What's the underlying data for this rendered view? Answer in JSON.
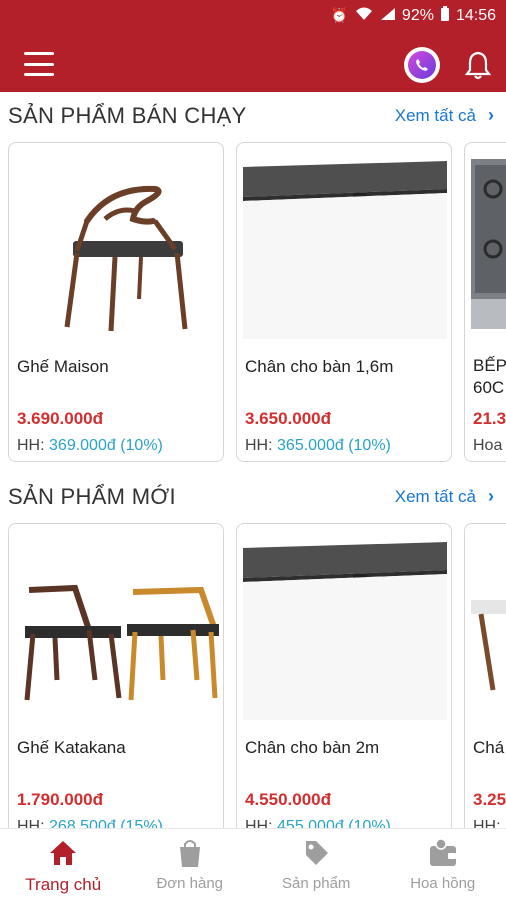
{
  "status": {
    "battery": "92%",
    "time": "14:56"
  },
  "colors": {
    "brand": "#b3202a",
    "price": "#d32f2f",
    "link": "#1976d2",
    "commission": "#29a3c7"
  },
  "sections": [
    {
      "title": "SẢN PHẨM BÁN CHẠY",
      "see_all": "Xem tất cả",
      "products": [
        {
          "name": "Ghế  Maison",
          "price": "3.690.000đ",
          "comm_label": "HH:",
          "comm_value": "369.000đ (10%)"
        },
        {
          "name": "Chân cho bàn 1,6m",
          "price": "3.650.000đ",
          "comm_label": "HH:",
          "comm_value": "365.000đ (10%)"
        },
        {
          "name": "BẾP",
          "name2": "60C",
          "price": "21.3",
          "comm_label": "Hoa"
        }
      ]
    },
    {
      "title": "SẢN PHẨM MỚI",
      "see_all": "Xem tất cả",
      "products": [
        {
          "name": "Ghế Katakana",
          "price": "1.790.000đ",
          "comm_label": "HH:",
          "comm_value": "268.500đ (15%)"
        },
        {
          "name": "Chân cho bàn 2m",
          "price": "4.550.000đ",
          "comm_label": "HH:",
          "comm_value": "455.000đ (10%)"
        },
        {
          "name": "Chá",
          "price": "3.25",
          "comm_label": "HH:"
        }
      ]
    }
  ],
  "nav": [
    {
      "label": "Trang chủ",
      "icon": "home-icon"
    },
    {
      "label": "Đơn hàng",
      "icon": "shopping-bag-icon"
    },
    {
      "label": "Sản phẩm",
      "icon": "product-tag-icon"
    },
    {
      "label": "Hoa hồng",
      "icon": "wallet-icon"
    }
  ]
}
